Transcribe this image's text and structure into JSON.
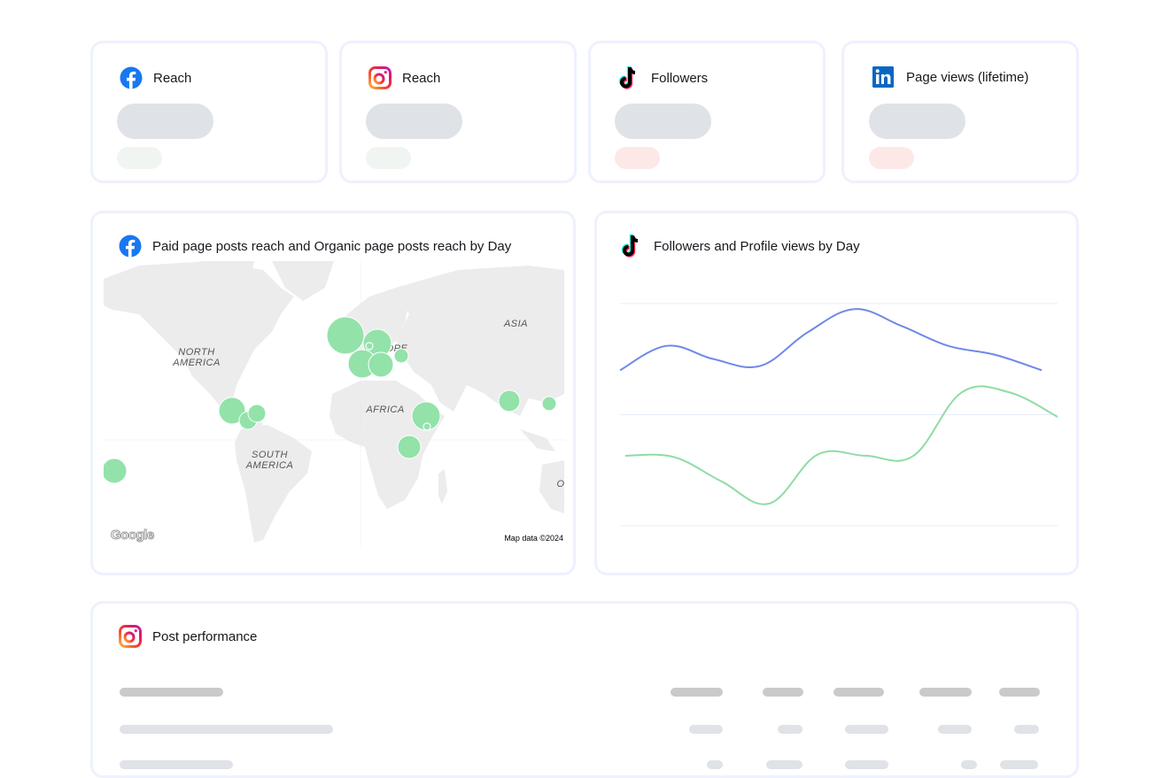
{
  "kpi_cards": [
    {
      "platform": "facebook",
      "icon": "facebook-icon",
      "title": "Reach",
      "delta_tone": "positive"
    },
    {
      "platform": "instagram",
      "icon": "instagram-icon",
      "title": "Reach",
      "delta_tone": "positive"
    },
    {
      "platform": "tiktok",
      "icon": "tiktok-icon",
      "title": "Followers",
      "delta_tone": "negative"
    },
    {
      "platform": "linkedin",
      "icon": "linkedin-icon",
      "title": "Page views (lifetime)",
      "delta_tone": "negative"
    }
  ],
  "map_card": {
    "icon": "facebook-icon",
    "title": "Paid page posts reach and Organic page posts reach by Day",
    "labels": {
      "north_america": "NORTH AMERICA",
      "south_america": "SOUTH AMERICA",
      "europe": "OPE",
      "africa": "AFRICA",
      "asia": "ASIA",
      "oceania": "O"
    },
    "attribution": "Map data ©2024",
    "logo": "Google",
    "bubble_color": "#93e2aa"
  },
  "line_card": {
    "icon": "tiktok-icon",
    "title": "Followers and Profile views by Day"
  },
  "chart_data": {
    "type": "line",
    "title": "Followers and Profile views by Day",
    "xlabel": "",
    "ylabel": "",
    "grid": true,
    "legend": "none",
    "x": [
      1,
      2,
      3,
      4,
      5,
      6,
      7,
      8,
      9,
      10
    ],
    "series": [
      {
        "name": "Followers",
        "color": "#7088e6",
        "values": [
          0.4,
          0.62,
          0.5,
          0.44,
          0.74,
          0.95,
          0.8,
          0.62,
          0.54,
          0.4
        ]
      },
      {
        "name": "Profile views",
        "color": "#8fdca4",
        "values": [
          -0.37,
          -0.38,
          -0.6,
          -0.8,
          -0.36,
          -0.37,
          -0.37,
          0.2,
          0.2,
          -0.02
        ]
      }
    ],
    "ylim": [
      -1,
      1
    ]
  },
  "post_performance": {
    "icon": "instagram-icon",
    "title": "Post performance"
  }
}
